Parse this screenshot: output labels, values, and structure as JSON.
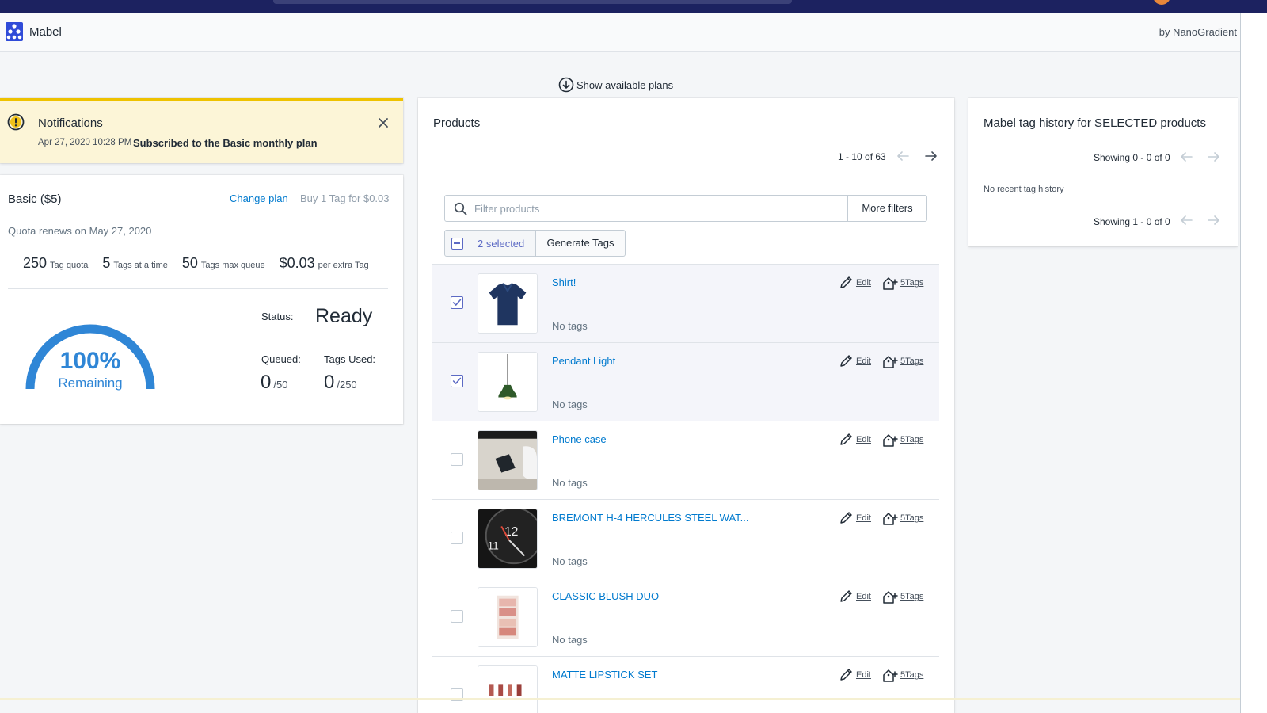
{
  "app": {
    "name": "Mabel",
    "byline": "by NanoGradient"
  },
  "show_plans_link": "Show available plans",
  "notification": {
    "title": "Notifications",
    "date": "Apr 27, 2020 10:28 PM",
    "message": "Subscribed to the Basic monthly plan"
  },
  "plan": {
    "name": "Basic ($5)",
    "change_plan": "Change plan",
    "buy_tag": "Buy 1 Tag for $0.03",
    "renews": "Quota renews on May 27, 2020",
    "quota": [
      {
        "value": "250",
        "label": "Tag quota"
      },
      {
        "value": "5",
        "label": "Tags at a time"
      },
      {
        "value": "50",
        "label": "Tags max queue"
      },
      {
        "value": "$0.03",
        "label": "per extra Tag"
      }
    ],
    "gauge": {
      "percent_text": "100%",
      "label": "Remaining",
      "fraction": 1.0,
      "color": "#2f86d6"
    },
    "status_label": "Status:",
    "status_value": "Ready",
    "queued_label": "Queued:",
    "queued_value": "0",
    "queued_max": "/50",
    "used_label": "Tags Used:",
    "used_value": "0",
    "used_max": "/250"
  },
  "products": {
    "title": "Products",
    "pager": "1 - 10 of 63",
    "filter_placeholder": "Filter products",
    "more_filters": "More filters",
    "selected_label": "2 selected",
    "generate_tags": "Generate Tags",
    "edit_label": "Edit",
    "stag_label": "5Tags",
    "items": [
      {
        "name": "Shirt!",
        "tags": "No tags",
        "selected": true,
        "thumb": "shirt"
      },
      {
        "name": "Pendant Light",
        "tags": "No tags",
        "selected": true,
        "thumb": "pendant-light"
      },
      {
        "name": "Phone case",
        "tags": "No tags",
        "selected": false,
        "thumb": "phone-case"
      },
      {
        "name": "BREMONT H-4 HERCULES STEEL WAT...",
        "tags": "No tags",
        "selected": false,
        "thumb": "watch"
      },
      {
        "name": "CLASSIC BLUSH DUO",
        "tags": "No tags",
        "selected": false,
        "thumb": "blush"
      },
      {
        "name": "MATTE LIPSTICK SET",
        "tags": "",
        "selected": false,
        "thumb": "lipstick"
      }
    ]
  },
  "history": {
    "title": "Mabel tag history for SELECTED products",
    "showing_top": "Showing 0 - 0 of 0",
    "empty": "No recent tag history",
    "showing_bottom": "Showing 1 - 0 of 0"
  },
  "colors": {
    "accent": "#5c6ac4",
    "link": "#007ace",
    "topbar": "#1c2260",
    "notice_bg": "#fcf5d7",
    "notice_border": "#eec200"
  }
}
